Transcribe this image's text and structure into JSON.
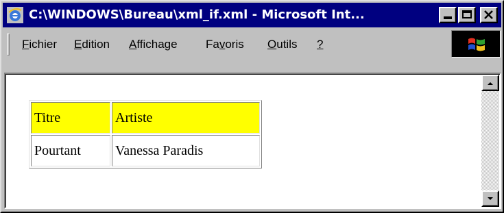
{
  "window": {
    "title": "C:\\WINDOWS\\Bureau\\xml_if.xml - Microsoft Int...",
    "app_icon": "internet-explorer-icon",
    "caption_buttons": [
      "minimize-icon",
      "maximize-icon",
      "close-icon"
    ]
  },
  "menubar": {
    "items": [
      {
        "accel": "F",
        "rest": "ichier"
      },
      {
        "accel": "E",
        "rest": "dition"
      },
      {
        "accel": "A",
        "rest": "ffichage"
      },
      {
        "pre": "Fa",
        "accel": "v",
        "rest": "oris"
      },
      {
        "accel": "O",
        "rest": "utils"
      },
      {
        "accel": "?",
        "rest": ""
      }
    ],
    "brand_icon": "windows-logo-icon"
  },
  "table": {
    "header": [
      "Titre",
      "Artiste"
    ],
    "rows": [
      [
        "Pourtant",
        "Vanessa Paradis"
      ]
    ],
    "header_color": "#ffff00"
  },
  "scrollbar": {
    "up_icon": "arrow-up-icon",
    "down_icon": "arrow-down-icon"
  },
  "colors": {
    "titlebar": "#000080",
    "face": "#c0c0c0"
  }
}
